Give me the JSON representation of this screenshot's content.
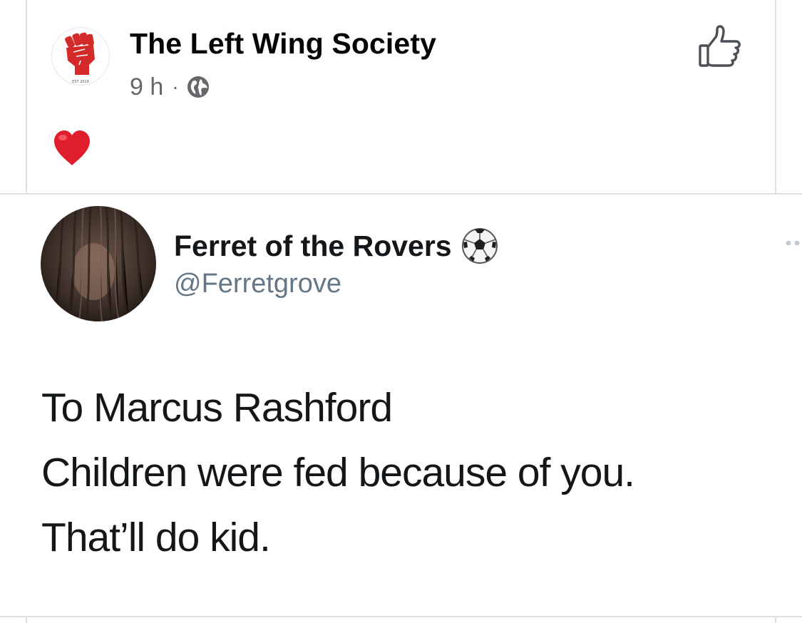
{
  "post": {
    "page_name": "The Left Wing Society",
    "time": "9 h",
    "separator": "·",
    "logo_text": "EST 2019",
    "reaction": "heart-emoji",
    "icons": [
      "fist-logo-icon",
      "globe-icon",
      "like-icon",
      "heart-icon"
    ],
    "colors": {
      "logo_red": "#d42a2a",
      "meta_gray": "#65676b",
      "divider": "#dddfe2"
    }
  },
  "tweet": {
    "display_name": "Ferret of the Rovers",
    "handle": "@Ferretgrove",
    "badge": "soccer-ball-icon",
    "lines": [
      "To Marcus Rashford",
      "Children were fed because of you.",
      "That’ll do kid."
    ],
    "colors": {
      "handle_gray": "#657786",
      "text": "#14171a"
    }
  }
}
